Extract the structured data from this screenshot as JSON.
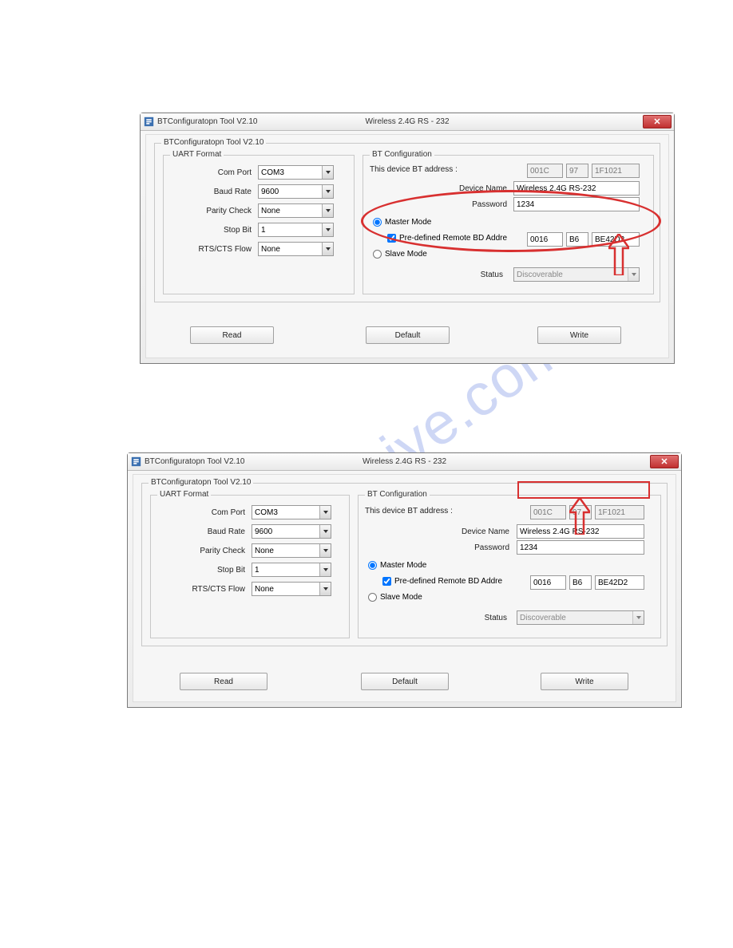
{
  "watermark": "manualshive.com",
  "window": {
    "icon": "bt-config-icon",
    "title_left": "BTConfiguratopn Tool V2.10",
    "title_center": "Wireless 2.4G RS - 232",
    "close_glyph": "✕"
  },
  "outer_group_label": "BTConfiguratopn Tool V2.10",
  "uart": {
    "group_label": "UART Format",
    "com_port_label": "Com Port",
    "com_port_value": "COM3",
    "baud_rate_label": "Baud Rate",
    "baud_rate_value": "9600",
    "parity_label": "Parity Check",
    "parity_value": "None",
    "stop_bit_label": "Stop Bit",
    "stop_bit_value": "1",
    "rtscts_label": "RTS/CTS Flow",
    "rtscts_value": "None"
  },
  "bt": {
    "group_label": "BT Configuration",
    "addr_label": "This device BT address :",
    "addr_a": "001C",
    "addr_b": "97",
    "addr_c": "1F1021",
    "name_label": "Device Name",
    "name_value": "Wireless 2.4G RS-232",
    "pass_label": "Password",
    "pass_value": "1234",
    "master_label": "Master Mode",
    "predef_label": "Pre-defined Remote BD Addre",
    "predef_a": "0016",
    "predef_b": "B6",
    "predef_c": "BE42D2",
    "slave_label": "Slave Mode",
    "status_label": "Status",
    "status_value": "Discoverable"
  },
  "buttons": {
    "read": "Read",
    "default": "Default",
    "write": "Write"
  }
}
